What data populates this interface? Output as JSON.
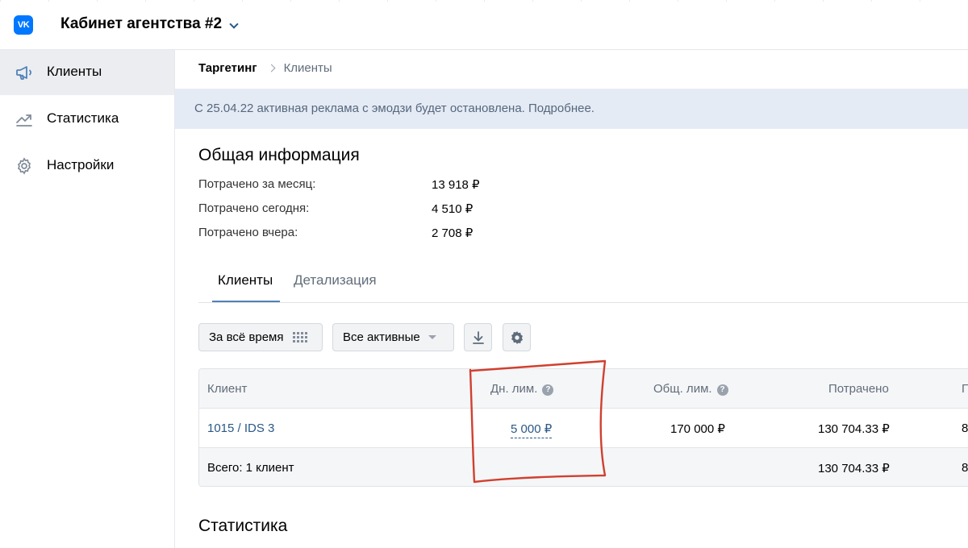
{
  "app": {
    "logo_text": "VK",
    "cabinet_title": "Кабинет агентства #2"
  },
  "sidebar": {
    "items": [
      {
        "label": "Клиенты",
        "icon": "megaphone-icon",
        "active": true
      },
      {
        "label": "Статистика",
        "icon": "trend-chart-icon",
        "active": false
      },
      {
        "label": "Настройки",
        "icon": "gear-icon",
        "active": false
      }
    ]
  },
  "breadcrumb": {
    "root": "Таргетинг",
    "current": "Клиенты"
  },
  "banner": {
    "text": "С 25.04.22 активная реклама с эмодзи будет остановлена. Подробнее."
  },
  "overview": {
    "title": "Общая информация",
    "rows": [
      {
        "label": "Потрачено за месяц:",
        "value": "13 918 ₽"
      },
      {
        "label": "Потрачено сегодня:",
        "value": "4 510 ₽"
      },
      {
        "label": "Потрачено вчера:",
        "value": "2 708 ₽"
      }
    ]
  },
  "tabs": [
    {
      "label": "Клиенты",
      "active": true
    },
    {
      "label": "Детализация",
      "active": false
    }
  ],
  "toolbar": {
    "period_label": "За всё время",
    "filter_label": "Все активные",
    "download_icon": "download-icon",
    "settings_icon": "gear-icon"
  },
  "table": {
    "headers": {
      "client": "Клиент",
      "daily_limit": "Дн. лим.",
      "total_limit": "Общ. лим.",
      "spent": "Потрачено",
      "cut_col": "П"
    },
    "row": {
      "client": "1015 / IDS 3",
      "daily_limit": "5 000 ₽",
      "total_limit": "170 000 ₽",
      "spent": "130 704.33 ₽",
      "cut_col": "8"
    },
    "footer": {
      "label": "Всего: 1 клиент",
      "spent": "130 704.33 ₽",
      "cut_col": "8"
    }
  },
  "statistics": {
    "title": "Статистика"
  },
  "colors": {
    "accent": "#2a5885",
    "vk_blue": "#0077ff",
    "banner_bg": "#e5ebf5",
    "annotation_red": "#d0402f"
  }
}
